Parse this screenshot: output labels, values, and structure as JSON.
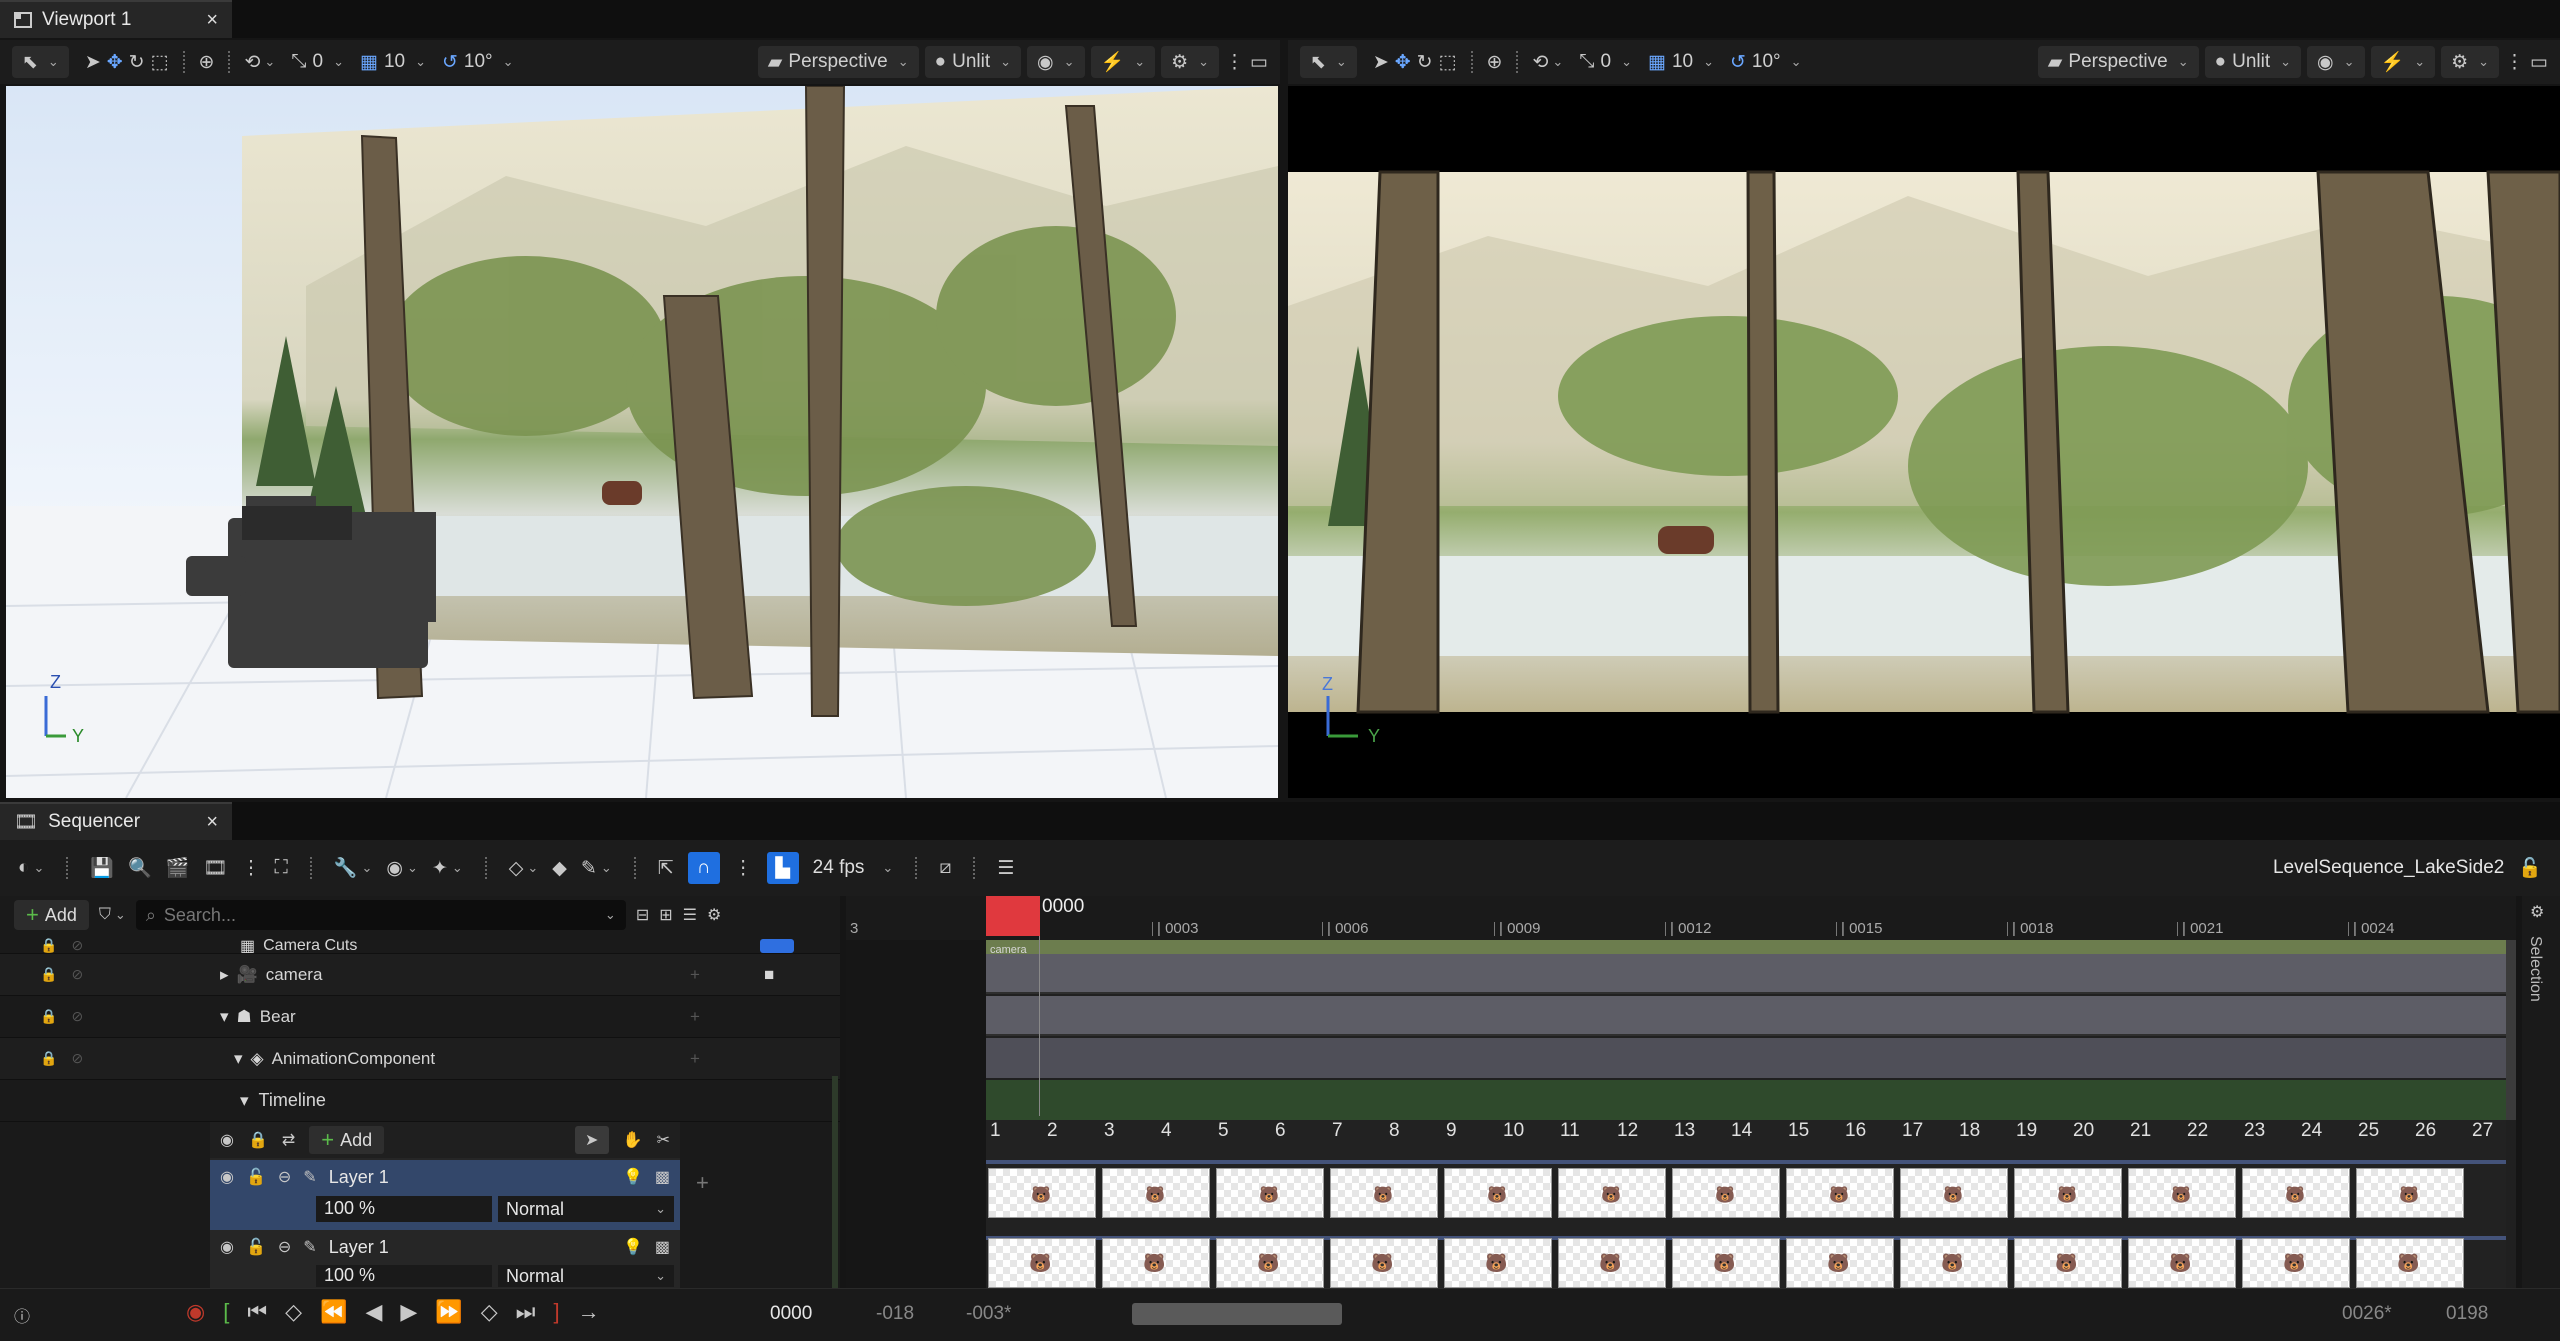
{
  "tabs": {
    "viewport": "Viewport 1",
    "sequencer": "Sequencer",
    "close": "×"
  },
  "viewport_toolbar": {
    "rotate_snap_value": "0",
    "grid_snap_value": "10",
    "angle_snap_value": "10°",
    "view_mode": "Perspective",
    "lighting_mode": "Unlit"
  },
  "axis": {
    "z": "Z",
    "y": "Y"
  },
  "sequencer_toolbar": {
    "fps": "24 fps",
    "sequence_name": "LevelSequence_LakeSide2",
    "selection_panel": "Selection"
  },
  "tree": {
    "add_label": "Add",
    "search_placeholder": "Search...",
    "items": [
      {
        "label": "Camera Cuts"
      },
      {
        "label": "camera"
      },
      {
        "label": "Bear"
      },
      {
        "label": "AnimationComponent"
      },
      {
        "label": "Timeline"
      }
    ],
    "timeline_add": "Add",
    "layers": [
      {
        "name": "Layer 1",
        "opacity": "100 %",
        "blend": "Normal"
      },
      {
        "name": "Layer 1",
        "opacity": "100 %",
        "blend": "Normal"
      }
    ]
  },
  "timeline": {
    "current_frame": "0000",
    "camera_label": "camera",
    "ruler": [
      "3",
      "| 0003",
      "| 0006",
      "| 0009",
      "| 0012",
      "| 0015",
      "| 0018",
      "| 0021",
      "| 0024"
    ],
    "frame_numbers": [
      "1",
      "2",
      "3",
      "4",
      "5",
      "6",
      "7",
      "8",
      "9",
      "10",
      "11",
      "12",
      "13",
      "14",
      "15",
      "16",
      "17",
      "18",
      "19",
      "20",
      "21",
      "22",
      "23",
      "24",
      "25",
      "26",
      "27"
    ]
  },
  "bottom": {
    "current_time": "0000",
    "view_start": "-018",
    "play_start": "-003*",
    "play_end": "0026*",
    "view_end": "0198"
  }
}
